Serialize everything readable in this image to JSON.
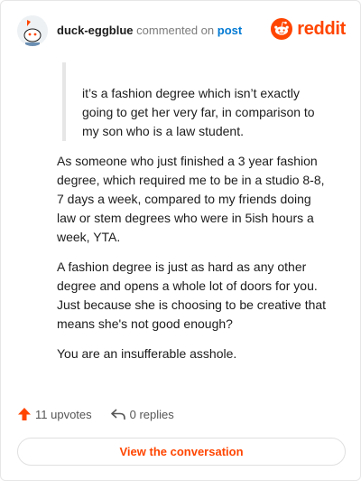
{
  "comment": {
    "username": "duck-eggblue",
    "action_text": "commented on",
    "post_link_label": "post"
  },
  "brand": {
    "name": "reddit",
    "color": "#ff4500",
    "icon": "reddit-logo-icon"
  },
  "quote": "it’s a fashion degree which isn’t exactly going to get her very far, in comparison to my son who is a law student.",
  "paragraphs": [
    "As someone who just finished a 3 year fashion degree, which required me to be in a studio 8-8, 7 days a week, compared to my friends doing law or stem degrees who were in 5ish hours a week, YTA.",
    "A fashion degree is just as hard as any other degree and opens a whole lot of doors for you. Just because she is choosing to be creative that means she's not good enough?",
    "You are an insufferable asshole."
  ],
  "stats": {
    "upvotes": "11 upvotes",
    "replies": "0 replies",
    "upvote_icon": "upvote-arrow-icon",
    "reply_icon": "reply-arrow-icon"
  },
  "view_button": "View the conversation"
}
